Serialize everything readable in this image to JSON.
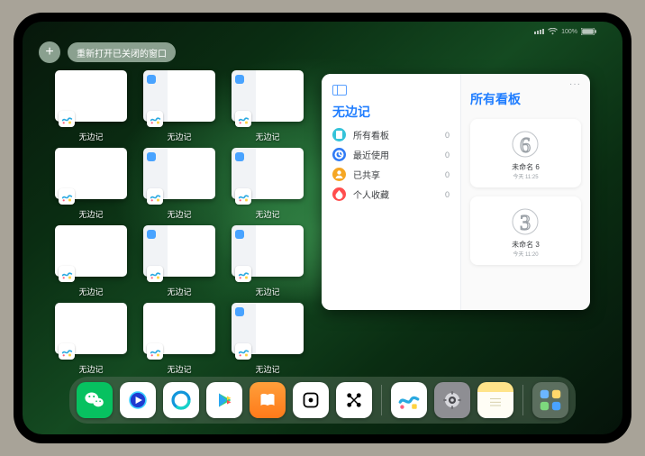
{
  "status": {
    "battery": "100%",
    "wifi_icon": "wifi-icon",
    "signal_icon": "signal-icon"
  },
  "header": {
    "plus_label": "+",
    "reopen_label": "重新打开已关闭的窗口"
  },
  "windows": [
    {
      "kind": "blank",
      "label": "无边记"
    },
    {
      "kind": "cal",
      "label": "无边记"
    },
    {
      "kind": "cal",
      "label": "无边记"
    },
    {
      "kind": "blank",
      "label": "无边记"
    },
    {
      "kind": "cal",
      "label": "无边记"
    },
    {
      "kind": "cal",
      "label": "无边记"
    },
    {
      "kind": "blank",
      "label": "无边记"
    },
    {
      "kind": "cal",
      "label": "无边记"
    },
    {
      "kind": "cal",
      "label": "无边记"
    },
    {
      "kind": "blank",
      "label": "无边记"
    },
    {
      "kind": "blank",
      "label": "无边记"
    },
    {
      "kind": "cal",
      "label": "无边记"
    }
  ],
  "panel": {
    "left_title": "无边记",
    "right_title": "所有看板",
    "menu": [
      {
        "icon_color": "#35c3d9",
        "glyph_color": "#ffffff",
        "label": "所有看板",
        "count": 0
      },
      {
        "icon_color": "#2f7af5",
        "glyph_color": "#ffffff",
        "label": "最近使用",
        "count": 0
      },
      {
        "icon_color": "#f5a623",
        "glyph_color": "#ffffff",
        "label": "已共享",
        "count": 0
      },
      {
        "icon_color": "#ff4d4d",
        "glyph_color": "#ffffff",
        "label": "个人收藏",
        "count": 0
      }
    ],
    "boards": [
      {
        "name": "未命名 6",
        "subtitle": "今天 11:25",
        "digit": "6"
      },
      {
        "name": "未命名 3",
        "subtitle": "今天 11:20",
        "digit": "3"
      }
    ],
    "ellipsis": "···"
  },
  "dock": {
    "items": [
      {
        "name": "wechat-icon",
        "bg": "#07c160"
      },
      {
        "name": "tencent-video-icon",
        "bg": "#ffffff"
      },
      {
        "name": "qq-browser-icon",
        "bg": "#ffffff"
      },
      {
        "name": "playstore-icon",
        "bg": "#ffffff"
      },
      {
        "name": "books-icon",
        "bg": "linear-gradient(#ff9f3a,#ff7a1a)"
      },
      {
        "name": "dice-icon",
        "bg": "#ffffff"
      },
      {
        "name": "connect-dots-icon",
        "bg": "#ffffff"
      },
      {
        "name": "freeform-icon",
        "bg": "#ffffff"
      },
      {
        "name": "settings-icon",
        "bg": "#8e8e93"
      },
      {
        "name": "notes-icon",
        "bg": "linear-gradient(#ffe48a 0 28%, #fffdf5 28% 100%)"
      },
      {
        "name": "app-library-icon",
        "bg": "rgba(255,255,255,0.22)"
      }
    ]
  }
}
